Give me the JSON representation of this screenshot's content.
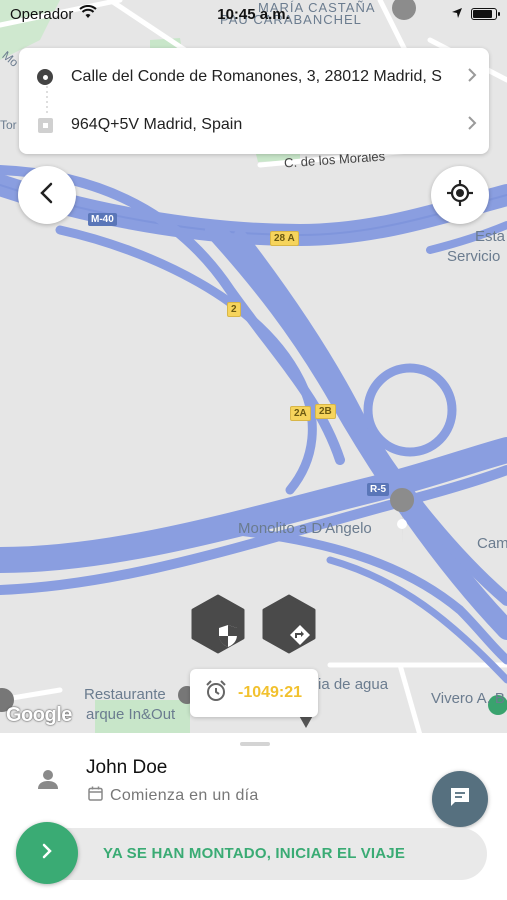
{
  "status_bar": {
    "carrier": "Operador",
    "time": "10:45 a.m.",
    "battery_level": 0.9
  },
  "route": {
    "origin": "Calle del Conde de Romanones, 3, 28012 Madrid, S",
    "destination": "964Q+5V Madrid, Spain",
    "origin_icon": "origin-dot-icon",
    "destination_icon": "destination-square-icon"
  },
  "map": {
    "labels": {
      "maria_castana": "MARÍA CASTAÑA",
      "pau_carabanchel": "PAU CARABANCHEL",
      "morales": "C. de los Morales",
      "esta": "Esta",
      "servicio": "Servicio",
      "monolito": "Monolito a D'Angelo",
      "cam": "Cam",
      "restaurante": "Restaurante",
      "parque": "arque In&Out",
      "agua": "ia de agua",
      "vivero": "Vivero A. B",
      "mo": "Mo",
      "tor": "Tor"
    },
    "shields": {
      "m40": "M-40",
      "r28a": "28 A",
      "r2": "2",
      "r2a": "2A",
      "r2b": "2B",
      "r5": "R-5"
    },
    "attribution": "Google"
  },
  "timer": {
    "value": "-1049:21",
    "icon": "alarm-clock-icon"
  },
  "driver": {
    "name": "John Doe",
    "subtitle": "Comienza en un día",
    "icon": "person-icon"
  },
  "actions": {
    "start_label": "YA SE HAN MONTADO, INICIAR EL VIAJE"
  },
  "colors": {
    "road": "#8a9ee0",
    "road_dark": "#6f86d0",
    "accent_green": "#3aab74",
    "timer_yellow": "#f2c12e",
    "chat_button": "#56707f",
    "hex_button": "#4a4a4a"
  }
}
